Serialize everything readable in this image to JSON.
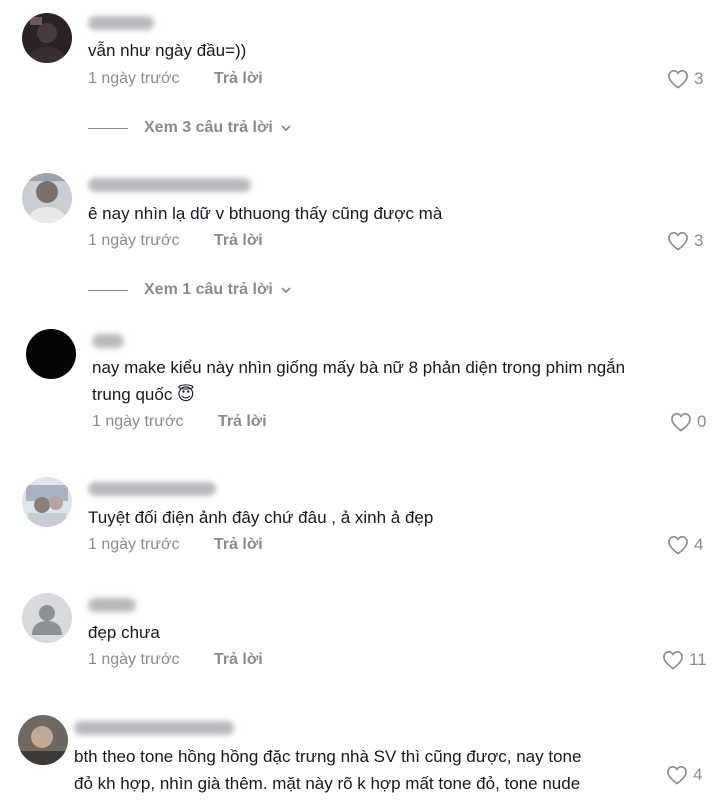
{
  "comments": [
    {
      "username": "sawako",
      "text_lines": [
        "vẫn như ngày đầu=))"
      ],
      "time": "1 ngày trước",
      "reply_label": "Trả lời",
      "likes": "3",
      "view_replies": "Xem 3 câu trả lời",
      "avatar_icon": "user-photo-avatar"
    },
    {
      "username": "ờ đây có bộ ba LCB",
      "text_lines": [
        "ê nay nhìn lạ dữ v bthuong thấy cũng được mà"
      ],
      "time": "1 ngày trước",
      "reply_label": "Trả lời",
      "likes": "3",
      "view_replies": "Xem 1 câu trả lời",
      "avatar_icon": "user-photo-avatar"
    },
    {
      "username": "kmi",
      "text_lines": [
        "nay make kiểu này nhìn giống mấy bà nữ 8 phản diện trong phim ngắn",
        "trung quốc 😇"
      ],
      "time": "1 ngày trước",
      "reply_label": "Trả lời",
      "likes": "0",
      "avatar_icon": "black-avatar"
    },
    {
      "username": "Bùi Thị Chuyền",
      "text_lines": [
        "Tuyệt đối điện ảnh đây chứ đâu , ả xinh ả đẹp"
      ],
      "time": "1 ngày trước",
      "reply_label": "Trả lời",
      "likes": "4",
      "avatar_icon": "user-photo-avatar"
    },
    {
      "username": "vinhq",
      "text_lines": [
        "đẹp chưa"
      ],
      "time": "1 ngày trước",
      "reply_label": "Trả lời",
      "likes": "11",
      "avatar_icon": "default-person-avatar"
    },
    {
      "username": "Giang Cam Tran",
      "text_lines": [
        "bth theo tone hồng hồng đặc trưng nhà SV thì cũng được, nay tone",
        "đỏ kh hợp, nhìn già thêm. mặt này rõ k hợp mất tone đỏ, tone nude"
      ],
      "likes": "4",
      "avatar_icon": "user-photo-avatar"
    }
  ],
  "icons": {
    "like": "heart-outline-icon",
    "expand": "chevron-down-icon"
  },
  "colors": {
    "text": "#161823",
    "secondary": "#8a8b91"
  }
}
